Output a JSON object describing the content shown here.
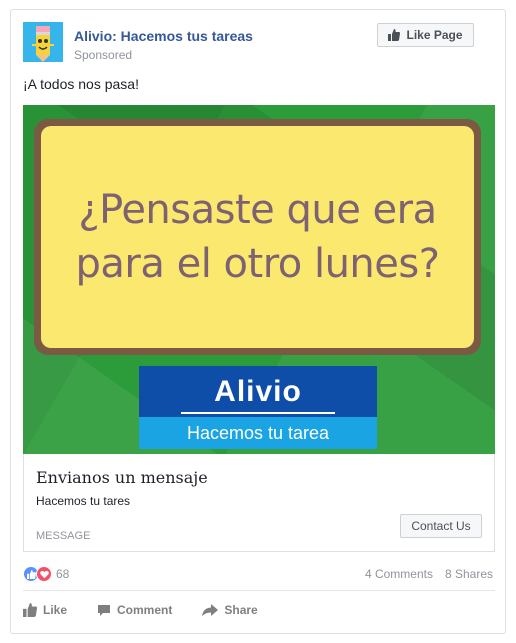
{
  "post": {
    "page_name": "Alivio: Hacemos tus tareas",
    "sponsored_label": "Sponsored",
    "like_page_label": "Like Page",
    "text": "¡A todos nos pasa!"
  },
  "creative": {
    "headline": "¿Pensaste que era para el otro lunes?",
    "brand_name": "Alivio",
    "brand_tagline": "Hacemos tu tarea",
    "colors": {
      "background": "#2c9b39",
      "board_frame": "#7b5a43",
      "board_fill": "#fbe96f",
      "brand_dark": "#0f4ea8",
      "brand_light": "#1aa4e3"
    }
  },
  "link": {
    "title": "Envianos un mensaje",
    "description": "Hacemos tu tares",
    "caption": "MESSAGE",
    "cta_label": "Contact Us"
  },
  "engagement": {
    "reaction_count": "68",
    "comments": "4 Comments",
    "shares": "8 Shares"
  },
  "actions": {
    "like": "Like",
    "comment": "Comment",
    "share": "Share"
  },
  "colors": {
    "link_blue": "#365899",
    "meta_gray": "#90949c"
  }
}
